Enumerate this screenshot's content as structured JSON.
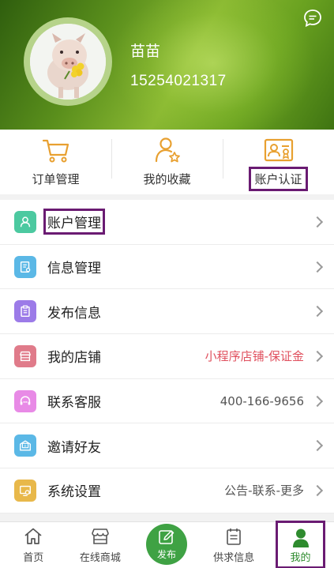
{
  "profile": {
    "name": "苗苗",
    "phone": "15254021317"
  },
  "quick_actions": [
    {
      "label": "订单管理",
      "icon": "cart-icon"
    },
    {
      "label": "我的收藏",
      "icon": "user-star-icon"
    },
    {
      "label": "账户认证",
      "icon": "id-card-icon"
    }
  ],
  "menu": [
    {
      "label": "账户管理",
      "icon": "person-icon",
      "color": "#4cc9a0",
      "extra": ""
    },
    {
      "label": "信息管理",
      "icon": "document-settings-icon",
      "color": "#5bb8e6",
      "extra": ""
    },
    {
      "label": "发布信息",
      "icon": "clipboard-icon",
      "color": "#9c7be8",
      "extra": ""
    },
    {
      "label": "我的店铺",
      "icon": "shop-icon",
      "color": "#e07b8a",
      "extra": "小程序店铺-保证金",
      "extra_color": "#e0505e"
    },
    {
      "label": "联系客服",
      "icon": "headset-icon",
      "color": "#e88ae6",
      "extra": "400-166-9656",
      "extra_color": "#555555"
    },
    {
      "label": "邀请好友",
      "icon": "invite-icon",
      "color": "#5bb8e6",
      "extra": ""
    },
    {
      "label": "系统设置",
      "icon": "settings-icon",
      "color": "#e8b84a",
      "extra": "公告-联系-更多",
      "extra_color": "#555555"
    }
  ],
  "nav": {
    "home": "首页",
    "mall": "在线商城",
    "publish": "发布",
    "supply": "供求信息",
    "me": "我的"
  },
  "colors": {
    "accent_green": "#3fa244",
    "highlight": "#6a1b72",
    "quick_icon": "#e8a030"
  }
}
